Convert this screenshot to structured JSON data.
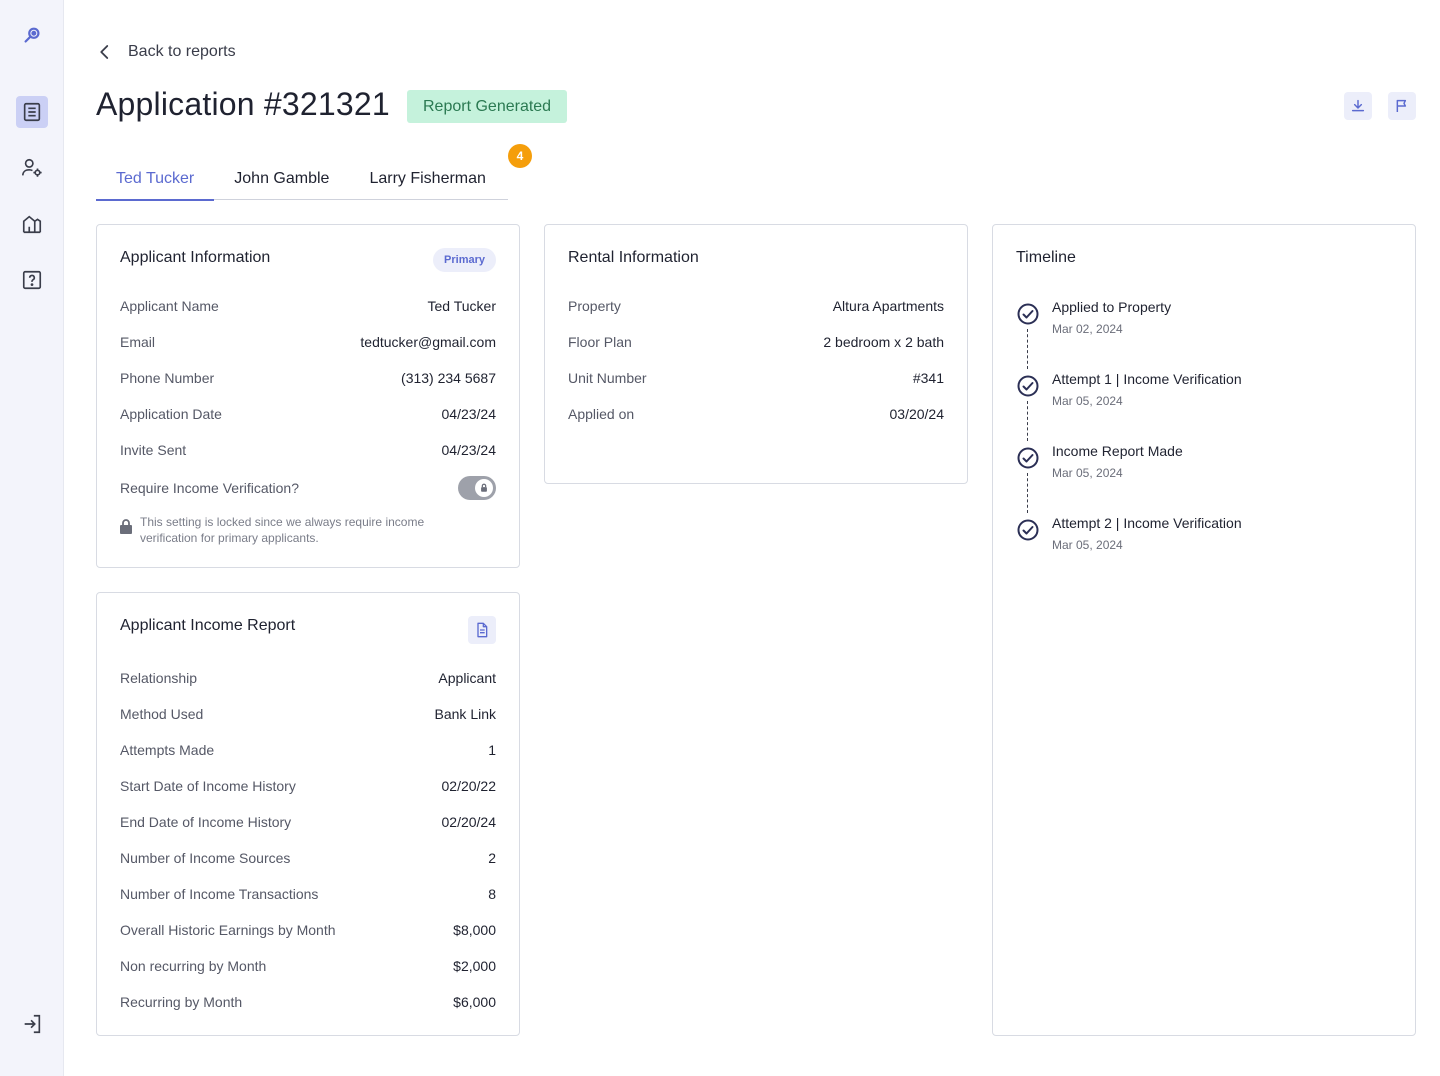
{
  "sidebar": {
    "items": [
      {
        "name": "logo-icon"
      },
      {
        "name": "reports-icon",
        "active": true
      },
      {
        "name": "user-settings-icon"
      },
      {
        "name": "properties-icon"
      },
      {
        "name": "help-icon"
      },
      {
        "name": "logout-icon"
      }
    ]
  },
  "header": {
    "back_label": "Back to reports",
    "title": "Application #321321",
    "status": "Report Generated"
  },
  "tabs": [
    {
      "label": "Ted Tucker",
      "active": true
    },
    {
      "label": "John Gamble",
      "active": false
    },
    {
      "label": "Larry Fisherman",
      "active": false
    }
  ],
  "tab_count": "4",
  "applicant_info": {
    "title": "Applicant Information",
    "badge": "Primary",
    "rows": [
      {
        "label": "Applicant Name",
        "value": "Ted Tucker"
      },
      {
        "label": "Email",
        "value": "tedtucker@gmail.com"
      },
      {
        "label": "Phone Number",
        "value": "(313) 234 5687"
      },
      {
        "label": "Application Date",
        "value": "04/23/24"
      },
      {
        "label": "Invite Sent",
        "value": "04/23/24"
      }
    ],
    "toggle_label": "Require Income Verification?",
    "lock_note": "This setting is locked since we always require income verification for primary applicants."
  },
  "income_report": {
    "title": "Applicant Income Report",
    "rows": [
      {
        "label": "Relationship",
        "value": "Applicant"
      },
      {
        "label": "Method Used",
        "value": "Bank Link"
      },
      {
        "label": "Attempts Made",
        "value": "1"
      },
      {
        "label": "Start Date of Income History",
        "value": "02/20/22"
      },
      {
        "label": "End Date of Income History",
        "value": "02/20/24"
      },
      {
        "label": "Number of Income Sources",
        "value": "2"
      },
      {
        "label": "Number of Income Transactions",
        "value": "8"
      },
      {
        "label": "Overall Historic Earnings by Month",
        "value": "$8,000"
      },
      {
        "label": "Non recurring by Month",
        "value": "$2,000"
      },
      {
        "label": "Recurring by Month",
        "value": "$6,000"
      }
    ]
  },
  "rental_info": {
    "title": "Rental Information",
    "rows": [
      {
        "label": "Property",
        "value": "Altura Apartments"
      },
      {
        "label": "Floor Plan",
        "value": "2 bedroom x 2 bath"
      },
      {
        "label": "Unit Number",
        "value": "#341"
      },
      {
        "label": "Applied on",
        "value": "03/20/24"
      }
    ]
  },
  "timeline": {
    "title": "Timeline",
    "items": [
      {
        "title": "Applied to Property",
        "date": "Mar 02, 2024"
      },
      {
        "title": "Attempt 1 | Income Verification",
        "date": "Mar 05, 2024"
      },
      {
        "title": "Income Report Made",
        "date": "Mar 05, 2024"
      },
      {
        "title": "Attempt 2 | Income Verification",
        "date": "Mar 05, 2024"
      }
    ]
  },
  "colors": {
    "accent": "#5b6ad0",
    "status_bg": "#c5f2dc",
    "status_text": "#2b7a52",
    "badge_orange": "#f59e0b",
    "sidebar_bg": "#f3f4fb"
  }
}
